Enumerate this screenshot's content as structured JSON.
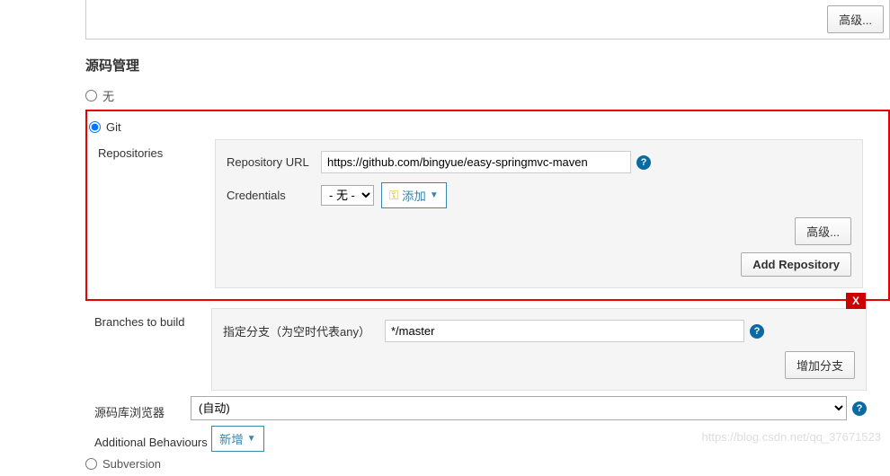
{
  "top": {
    "advanced": "高级..."
  },
  "section": {
    "title": "源码管理"
  },
  "scm": {
    "none_label": "无",
    "git_label": "Git",
    "subversion_label": "Subversion"
  },
  "repositories": {
    "label": "Repositories",
    "url_label": "Repository URL",
    "url_value": "https://github.com/bingyue/easy-springmvc-maven",
    "credentials_label": "Credentials",
    "credentials_none": "- 无 -",
    "add_button": "添加",
    "advanced_button": "高级...",
    "add_repo_button": "Add Repository"
  },
  "branches": {
    "label": "Branches to build",
    "spec_label": "指定分支（为空时代表any）",
    "spec_value": "*/master",
    "add_branch_button": "增加分支"
  },
  "browser": {
    "label": "源码库浏览器",
    "auto_option": "(自动)"
  },
  "behaviours": {
    "label": "Additional Behaviours",
    "new_button": "新增"
  },
  "watermark": "https://blog.csdn.net/qq_37671523"
}
